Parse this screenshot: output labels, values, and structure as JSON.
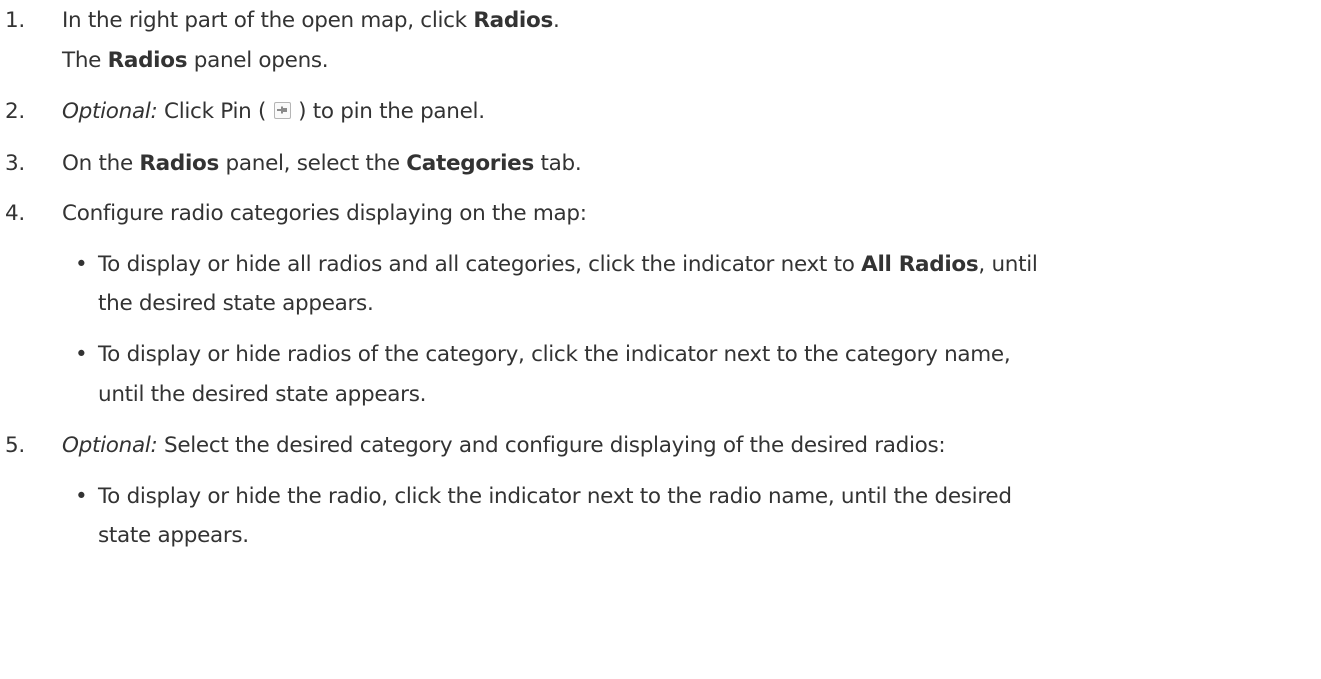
{
  "steps": [
    {
      "number": "1.",
      "line1": {
        "pre": "In the right part of the open map, click ",
        "bold": "Radios",
        "post": "."
      },
      "line2": {
        "pre": "The ",
        "bold": "Radios",
        "post": " panel opens."
      }
    },
    {
      "number": "2.",
      "optional_label": "Optional:",
      "pre": " Click Pin ( ",
      "icon": "pin-icon",
      "post": " ) to pin the panel."
    },
    {
      "number": "3.",
      "pre": "On the ",
      "bold1": "Radios",
      "mid": " panel, select the ",
      "bold2": "Categories",
      "post": " tab."
    },
    {
      "number": "4.",
      "text": "Configure radio categories displaying on the map:",
      "bullets": [
        {
          "marker": "•",
          "line1_pre": "To display or hide all radios and all categories, click the indicator next to ",
          "line1_bold": "All Radios",
          "line1_post": ", until",
          "line2": "the desired state appears."
        },
        {
          "marker": "•",
          "line1": "To display or hide radios of the category, click the indicator next to the category name,",
          "line2": "until the desired state appears."
        }
      ]
    },
    {
      "number": "5.",
      "optional_label": "Optional:",
      "text": " Select the desired category and configure displaying of the desired radios:",
      "bullets": [
        {
          "marker": "•",
          "line1": "To display or hide the radio, click the indicator next to the radio name, until the desired",
          "line2": "state appears."
        }
      ]
    }
  ]
}
